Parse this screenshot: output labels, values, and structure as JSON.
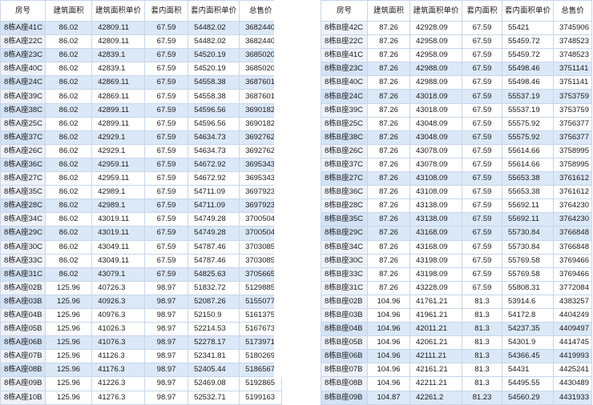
{
  "headers": [
    "房号",
    "建筑面积",
    "建筑面积单价",
    "套内面积",
    "套内面积单价",
    "总售价"
  ],
  "left_table": {
    "rows": [
      {
        "cells": [
          "8栋A座41C",
          "86.02",
          "42809.11",
          "67.59",
          "54482.02",
          "3682440"
        ],
        "highlight": true
      },
      {
        "cells": [
          "8栋A座22C",
          "86.02",
          "42809.11",
          "67.59",
          "54482.02",
          "3682440"
        ],
        "highlight": false
      },
      {
        "cells": [
          "8栋A座23C",
          "86.02",
          "42839.1",
          "67.59",
          "54520.19",
          "3685020"
        ],
        "highlight": true
      },
      {
        "cells": [
          "8栋A座40C",
          "86.02",
          "42839.1",
          "67.59",
          "54520.19",
          "3685020"
        ],
        "highlight": false
      },
      {
        "cells": [
          "8栋A座24C",
          "86.02",
          "42869.11",
          "67.59",
          "54558.38",
          "3687601"
        ],
        "highlight": true
      },
      {
        "cells": [
          "8栋A座39C",
          "86.02",
          "42869.11",
          "67.59",
          "54558.38",
          "3687601"
        ],
        "highlight": false
      },
      {
        "cells": [
          "8栋A座38C",
          "86.02",
          "42899.11",
          "67.59",
          "54596.56",
          "3690182"
        ],
        "highlight": true
      },
      {
        "cells": [
          "8栋A座25C",
          "86.02",
          "42899.11",
          "67.59",
          "54596.56",
          "3690182"
        ],
        "highlight": false
      },
      {
        "cells": [
          "8栋A座37C",
          "86.02",
          "42929.1",
          "67.59",
          "54634.73",
          "3692762"
        ],
        "highlight": true
      },
      {
        "cells": [
          "8栋A座26C",
          "86.02",
          "42929.1",
          "67.59",
          "54634.73",
          "3692762"
        ],
        "highlight": false
      },
      {
        "cells": [
          "8栋A座36C",
          "86.02",
          "42959.11",
          "67.59",
          "54672.92",
          "3695343"
        ],
        "highlight": true
      },
      {
        "cells": [
          "8栋A座27C",
          "86.02",
          "42959.11",
          "67.59",
          "54672.92",
          "3695343"
        ],
        "highlight": false
      },
      {
        "cells": [
          "8栋A座35C",
          "86.02",
          "42989.1",
          "67.59",
          "54711.09",
          "3697923"
        ],
        "highlight": false
      },
      {
        "cells": [
          "8栋A座28C",
          "86.02",
          "42989.1",
          "67.59",
          "54711.09",
          "3697923"
        ],
        "highlight": true
      },
      {
        "cells": [
          "8栋A座34C",
          "86.02",
          "43019.11",
          "67.59",
          "54749.28",
          "3700504"
        ],
        "highlight": false
      },
      {
        "cells": [
          "8栋A座29C",
          "86.02",
          "43019.11",
          "67.59",
          "54749.28",
          "3700504"
        ],
        "highlight": true
      },
      {
        "cells": [
          "8栋A座30C",
          "86.02",
          "43049.11",
          "67.59",
          "54787.46",
          "3703085"
        ],
        "highlight": false
      },
      {
        "cells": [
          "8栋A座33C",
          "86.02",
          "43049.11",
          "67.59",
          "54787.46",
          "3703085"
        ],
        "highlight": false
      },
      {
        "cells": [
          "8栋A座31C",
          "86.02",
          "43079.1",
          "67.59",
          "54825.63",
          "3705665"
        ],
        "highlight": true
      },
      {
        "cells": [
          "8栋A座02B",
          "125.96",
          "40726.3",
          "98.97",
          "51832.72",
          "5129885"
        ],
        "highlight": false
      },
      {
        "cells": [
          "8栋A座03B",
          "125.96",
          "40926.3",
          "98.97",
          "52087.26",
          "5155077"
        ],
        "highlight": true
      },
      {
        "cells": [
          "8栋A座04B",
          "125.96",
          "40976.3",
          "98.97",
          "52150.9",
          "5161375"
        ],
        "highlight": false
      },
      {
        "cells": [
          "8栋A座05B",
          "125.96",
          "41026.3",
          "98.97",
          "52214.53",
          "5167673"
        ],
        "highlight": false
      },
      {
        "cells": [
          "8栋A座06B",
          "125.96",
          "41076.3",
          "98.97",
          "52278.17",
          "5173971"
        ],
        "highlight": true
      },
      {
        "cells": [
          "8栋A座07B",
          "125.96",
          "41126.3",
          "98.97",
          "52341.81",
          "5180269"
        ],
        "highlight": false
      },
      {
        "cells": [
          "8栋A座08B",
          "125.96",
          "41176.3",
          "98.97",
          "52405.44",
          "5186567"
        ],
        "highlight": true
      },
      {
        "cells": [
          "8栋A座09B",
          "125.96",
          "41226.3",
          "98.97",
          "52469.08",
          "5192865"
        ],
        "highlight": false
      },
      {
        "cells": [
          "8栋A座10B",
          "125.96",
          "41276.3",
          "98.97",
          "52532.71",
          "5199163"
        ],
        "highlight": false
      }
    ]
  },
  "right_table": {
    "rows": [
      {
        "cells": [
          "8栋B座42C",
          "87.26",
          "42928.09",
          "67.59",
          "55421",
          "3745906"
        ],
        "highlight": false
      },
      {
        "cells": [
          "8栋B座22C",
          "87.26",
          "42958.09",
          "67.59",
          "55459.72",
          "3748523"
        ],
        "highlight": false
      },
      {
        "cells": [
          "8栋B座41C",
          "87.26",
          "42958.09",
          "67.59",
          "55459.72",
          "3748523"
        ],
        "highlight": false
      },
      {
        "cells": [
          "8栋B座23C",
          "87.26",
          "42988.09",
          "67.59",
          "55498.46",
          "3751141"
        ],
        "highlight": true
      },
      {
        "cells": [
          "8栋B座40C",
          "87.26",
          "42988.09",
          "67.59",
          "55498.46",
          "3751141"
        ],
        "highlight": false
      },
      {
        "cells": [
          "8栋B座24C",
          "87.26",
          "43018.09",
          "67.59",
          "55537.19",
          "3753759"
        ],
        "highlight": true
      },
      {
        "cells": [
          "8栋B座39C",
          "87.26",
          "43018.09",
          "67.59",
          "55537.19",
          "3753759"
        ],
        "highlight": false
      },
      {
        "cells": [
          "8栋B座25C",
          "87.26",
          "43048.09",
          "67.59",
          "55575.92",
          "3756377"
        ],
        "highlight": false
      },
      {
        "cells": [
          "8栋B座38C",
          "87.26",
          "43048.09",
          "67.59",
          "55575.92",
          "3756377"
        ],
        "highlight": true
      },
      {
        "cells": [
          "8栋B座26C",
          "87.26",
          "43078.09",
          "67.59",
          "55614.66",
          "3758995"
        ],
        "highlight": false
      },
      {
        "cells": [
          "8栋B座37C",
          "87.26",
          "43078.09",
          "67.59",
          "55614.66",
          "3758995"
        ],
        "highlight": false
      },
      {
        "cells": [
          "8栋B座27C",
          "87.26",
          "43108.09",
          "67.59",
          "55653.38",
          "3761612"
        ],
        "highlight": true
      },
      {
        "cells": [
          "8栋B座36C",
          "87.26",
          "43108.09",
          "67.59",
          "55653.38",
          "3761612"
        ],
        "highlight": false
      },
      {
        "cells": [
          "8栋B座28C",
          "87.26",
          "43138.09",
          "67.59",
          "55692.11",
          "3764230"
        ],
        "highlight": false
      },
      {
        "cells": [
          "8栋B座35C",
          "87.26",
          "43138.09",
          "67.59",
          "55692.11",
          "3764230"
        ],
        "highlight": true
      },
      {
        "cells": [
          "8栋B座29C",
          "87.26",
          "43168.09",
          "67.59",
          "55730.84",
          "3766848"
        ],
        "highlight": true
      },
      {
        "cells": [
          "8栋B座34C",
          "87.26",
          "43168.09",
          "67.59",
          "55730.84",
          "3766848"
        ],
        "highlight": false
      },
      {
        "cells": [
          "8栋B座30C",
          "87.26",
          "43198.09",
          "67.59",
          "55769.58",
          "3769466"
        ],
        "highlight": false
      },
      {
        "cells": [
          "8栋B座33C",
          "87.26",
          "43198.09",
          "67.59",
          "55769.58",
          "3769466"
        ],
        "highlight": false
      },
      {
        "cells": [
          "8栋B座31C",
          "87.26",
          "43228.09",
          "67.59",
          "55808.31",
          "3772084"
        ],
        "highlight": false
      },
      {
        "cells": [
          "8栋B座02B",
          "104.96",
          "41761.21",
          "81.3",
          "53914.6",
          "4383257"
        ],
        "highlight": false
      },
      {
        "cells": [
          "8栋B座03B",
          "104.96",
          "41961.21",
          "81.3",
          "54172.8",
          "4404249"
        ],
        "highlight": false
      },
      {
        "cells": [
          "8栋B座04B",
          "104.96",
          "42011.21",
          "81.3",
          "54237.35",
          "4409497"
        ],
        "highlight": true
      },
      {
        "cells": [
          "8栋B座05B",
          "104.96",
          "42061.21",
          "81.3",
          "54301.9",
          "4414745"
        ],
        "highlight": false
      },
      {
        "cells": [
          "8栋B座06B",
          "104.96",
          "42111.21",
          "81.3",
          "54366.45",
          "4419993"
        ],
        "highlight": true
      },
      {
        "cells": [
          "8栋B座07B",
          "104.96",
          "42161.21",
          "81.3",
          "54431",
          "4425241"
        ],
        "highlight": false
      },
      {
        "cells": [
          "8栋B座08B",
          "104.96",
          "42211.21",
          "81.3",
          "54495.55",
          "4430489"
        ],
        "highlight": false
      },
      {
        "cells": [
          "8栋B座09B",
          "104.87",
          "42261.2",
          "81.23",
          "54560.29",
          "4431933"
        ],
        "highlight": true
      }
    ]
  }
}
